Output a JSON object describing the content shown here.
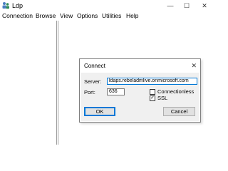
{
  "window": {
    "title": "Ldp",
    "icon": "ldp-app-icon",
    "controls": {
      "minimize": "—",
      "maximize": "☐",
      "close": "✕"
    }
  },
  "menubar": {
    "items": [
      "Connection",
      "Browse",
      "View",
      "Options",
      "Utilities",
      "Help"
    ]
  },
  "dialog": {
    "title": "Connect",
    "close_glyph": "✕",
    "server_label": "Server:",
    "server_value": "ldaps.rebeladmlive.onmicrosoft.com",
    "port_label": "Port:",
    "port_value": "636",
    "connectionless_label": "Connectionless",
    "connectionless_checked": false,
    "ssl_label": "SSL",
    "ssl_checked": true,
    "ssl_check_glyph": "✓",
    "ok_label": "OK",
    "cancel_label": "Cancel"
  },
  "colors": {
    "accent": "#0078d7",
    "dialog_body": "#f0f0f0"
  }
}
